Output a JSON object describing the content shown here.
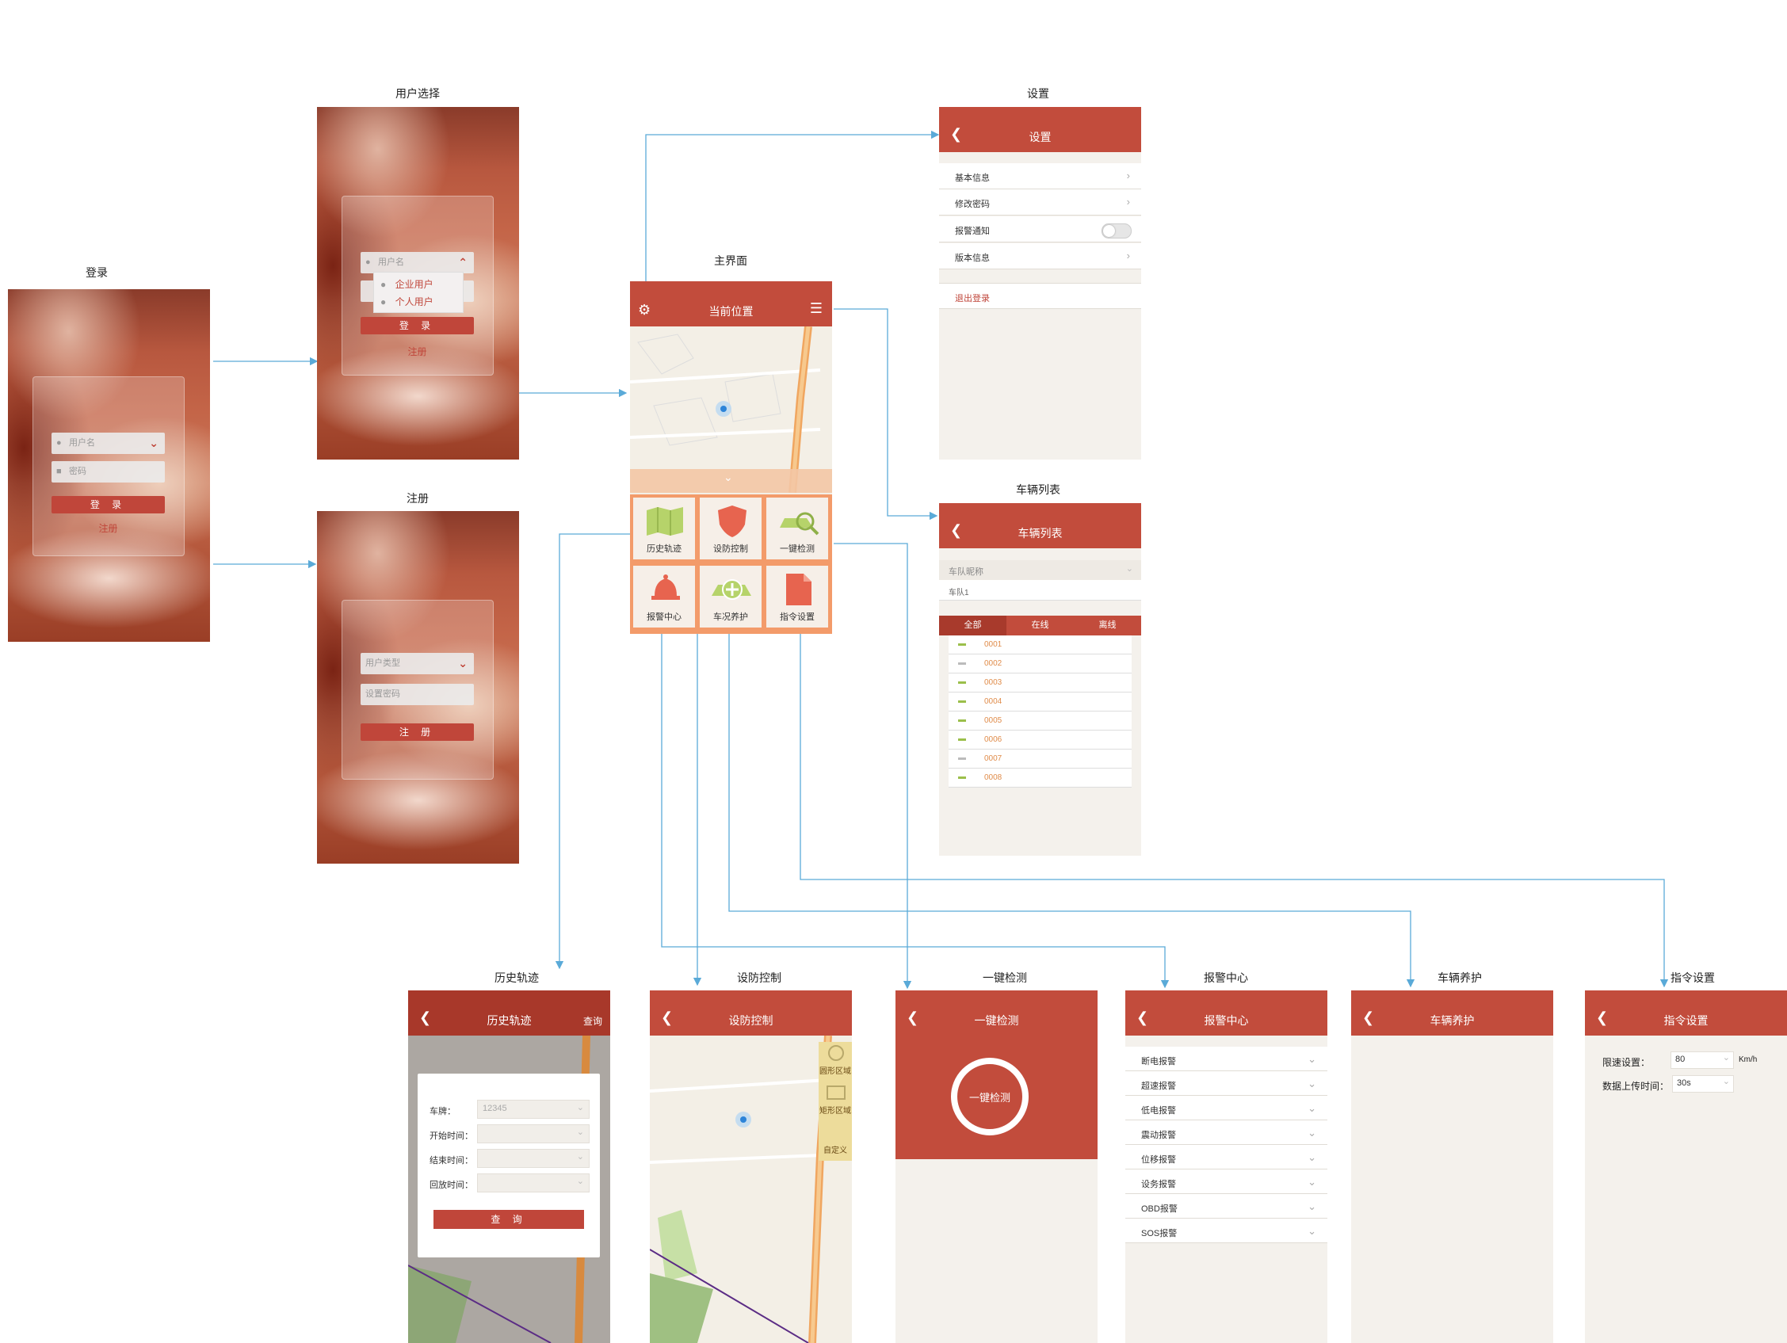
{
  "labels": {
    "login": "登录",
    "user_select": "用户选择",
    "register": "注册",
    "main": "主界面",
    "settings": "设置",
    "vehicle_list": "车辆列表",
    "history": "历史轨迹",
    "defense": "设防控制",
    "check": "一键检测",
    "alarm": "报警中心",
    "maintenance": "车辆养护",
    "command": "指令设置"
  },
  "login": {
    "username_placeholder": "用户名",
    "password_placeholder": "密码",
    "login_button": "登 录",
    "register_link": "注册"
  },
  "user_select": {
    "username_placeholder": "用户名",
    "option_enterprise": "企业用户",
    "option_personal": "个人用户",
    "login_button": "登 录",
    "register_link": "注册"
  },
  "register": {
    "user_type_placeholder": "用户类型",
    "password_placeholder": "设置密码",
    "register_button": "注 册"
  },
  "main": {
    "title": "当前位置",
    "grid": [
      "历史轨迹",
      "设防控制",
      "一键检测",
      "报警中心",
      "车况养护",
      "指令设置"
    ]
  },
  "settings": {
    "title": "设置",
    "items": [
      "基本信息",
      "修改密码",
      "报警通知",
      "版本信息"
    ],
    "logout": "退出登录"
  },
  "vehicle_list": {
    "title": "车辆列表",
    "fleet_label": "车队昵称",
    "fleet_value": "车队1",
    "tabs": [
      "全部",
      "在线",
      "离线"
    ],
    "vehicles": [
      "0001",
      "0002",
      "0003",
      "0004",
      "0005",
      "0006",
      "0007",
      "0008"
    ]
  },
  "history": {
    "title": "历史轨迹",
    "query_link": "查询",
    "plate_label": "车牌：",
    "plate_value": "12345",
    "start_label": "开始时间：",
    "end_label": "结束时间：",
    "playback_label": "回放时间：",
    "query_button": "查 询"
  },
  "defense": {
    "title": "设防控制",
    "zones": [
      "圆形区域",
      "矩形区域",
      "自定义"
    ]
  },
  "check": {
    "title": "一键检测",
    "button": "一键检测"
  },
  "alarm": {
    "title": "报警中心",
    "items": [
      "断电报警",
      "超速报警",
      "低电报警",
      "震动报警",
      "位移报警",
      "设务报警",
      "OBD报警",
      "SOS报警"
    ]
  },
  "maintenance": {
    "title": "车辆养护"
  },
  "command": {
    "title": "指令设置",
    "speed_label": "限速设置：",
    "speed_value": "80",
    "speed_unit": "Km/h",
    "upload_label": "数据上传时间：",
    "upload_value": "30s"
  },
  "colors": {
    "brand_red": "#c24c3c",
    "accent_orange": "#f39b6a",
    "connector_blue": "#5aaad8"
  }
}
